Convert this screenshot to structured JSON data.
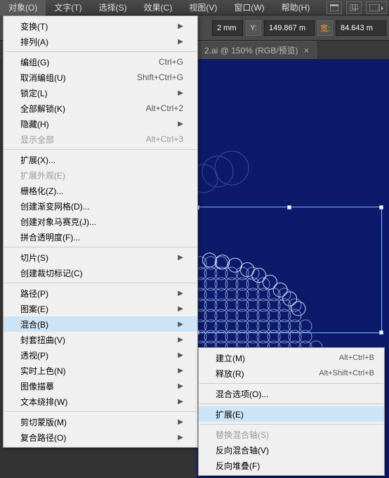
{
  "menubar": {
    "items": [
      "对象(O)",
      "文字(T)",
      "选择(S)",
      "效果(C)",
      "视图(V)",
      "窗口(W)",
      "帮助(H)"
    ]
  },
  "toolbar": {
    "x_suffix": "2 mm",
    "y_label": "Y:",
    "y_value": "149.867 m",
    "w_label": "宽:",
    "w_value": "84.643 m"
  },
  "tab": {
    "title": "2.ai @ 150% (RGB/预览)",
    "close": "×"
  },
  "menu": {
    "items": [
      {
        "label": "变换(T)",
        "sub": true
      },
      {
        "label": "排列(A)",
        "sub": true
      },
      {
        "sep": true
      },
      {
        "label": "编组(G)",
        "shortcut": "Ctrl+G"
      },
      {
        "label": "取消编组(U)",
        "shortcut": "Shift+Ctrl+G"
      },
      {
        "label": "锁定(L)",
        "sub": true
      },
      {
        "label": "全部解锁(K)",
        "shortcut": "Alt+Ctrl+2"
      },
      {
        "label": "隐藏(H)",
        "sub": true
      },
      {
        "label": "显示全部",
        "shortcut": "Alt+Ctrl+3",
        "disabled": true
      },
      {
        "sep": true
      },
      {
        "label": "扩展(X)..."
      },
      {
        "label": "扩展外观(E)",
        "disabled": true
      },
      {
        "label": "栅格化(Z)..."
      },
      {
        "label": "创建渐变网格(D)..."
      },
      {
        "label": "创建对象马赛克(J)..."
      },
      {
        "label": "拼合透明度(F)..."
      },
      {
        "sep": true
      },
      {
        "label": "切片(S)",
        "sub": true
      },
      {
        "label": "创建裁切标记(C)"
      },
      {
        "sep": true
      },
      {
        "label": "路径(P)",
        "sub": true
      },
      {
        "label": "图案(E)",
        "sub": true
      },
      {
        "label": "混合(B)",
        "sub": true,
        "hl": true
      },
      {
        "label": "封套扭曲(V)",
        "sub": true
      },
      {
        "label": "透视(P)",
        "sub": true
      },
      {
        "label": "实时上色(N)",
        "sub": true
      },
      {
        "label": "图像描摹",
        "sub": true
      },
      {
        "label": "文本绕排(W)",
        "sub": true
      },
      {
        "sep": true
      },
      {
        "label": "剪切蒙版(M)",
        "sub": true
      },
      {
        "label": "复合路径(O)",
        "sub": true
      }
    ]
  },
  "submenu": {
    "items": [
      {
        "label": "建立(M)",
        "shortcut": "Alt+Ctrl+B"
      },
      {
        "label": "释放(R)",
        "shortcut": "Alt+Shift+Ctrl+B"
      },
      {
        "sep": true
      },
      {
        "label": "混合选项(O)..."
      },
      {
        "sep": true
      },
      {
        "label": "扩展(E)",
        "hl": true
      },
      {
        "sep": true
      },
      {
        "label": "替换混合轴(S)",
        "disabled": true
      },
      {
        "label": "反向混合轴(V)"
      },
      {
        "label": "反向堆叠(F)"
      }
    ]
  }
}
